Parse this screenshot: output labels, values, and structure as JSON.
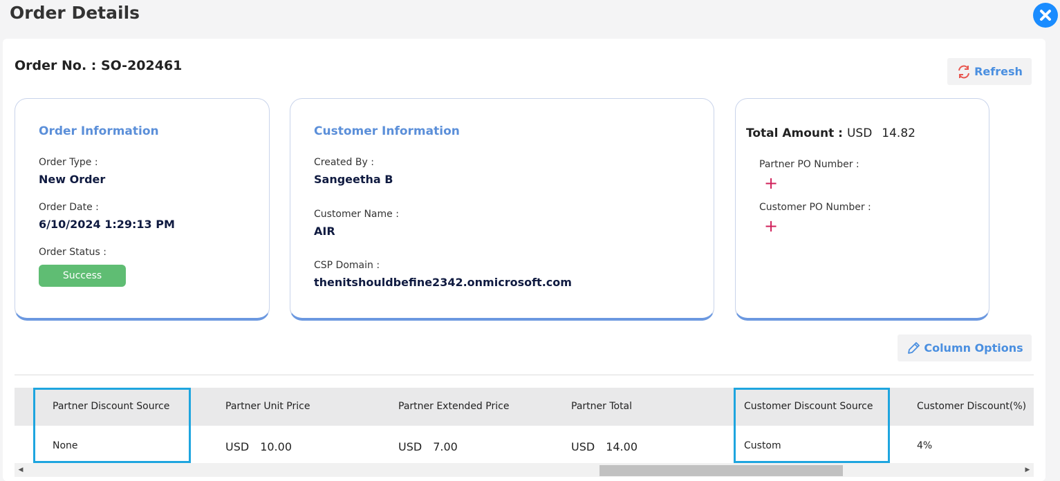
{
  "header": {
    "title": "Order Details"
  },
  "order": {
    "number_label": "Order No. : SO-202461"
  },
  "toolbar": {
    "refresh_label": "Refresh",
    "column_options_label": "Column Options"
  },
  "order_info": {
    "heading": "Order Information",
    "type_label": "Order Type :",
    "type_value": "New Order",
    "date_label": "Order Date :",
    "date_value": "6/10/2024 1:29:13 PM",
    "status_label": "Order Status :",
    "status_value": "Success"
  },
  "customer_info": {
    "heading": "Customer Information",
    "created_by_label": "Created By :",
    "created_by_value": "Sangeetha B",
    "customer_name_label": "Customer Name :",
    "customer_name_value": "AIR",
    "csp_domain_label": "CSP Domain :",
    "csp_domain_value": "thenitshouldbefine2342.onmicrosoft.com"
  },
  "totals": {
    "total_label": "Total Amount :",
    "currency": "USD",
    "amount": "14.82",
    "partner_po_label": "Partner PO Number :",
    "customer_po_label": "Customer PO Number :"
  },
  "table": {
    "columns": [
      "Partner Discount Source",
      "Partner Unit Price",
      "Partner Extended Price",
      "Partner Total",
      "Customer Discount Source",
      "Customer Discount(%)"
    ],
    "row": {
      "partner_discount_source": "None",
      "partner_unit_price": {
        "currency": "USD",
        "value": "10.00"
      },
      "partner_extended_price": {
        "currency": "USD",
        "value": "7.00"
      },
      "partner_total": {
        "currency": "USD",
        "value": "14.00"
      },
      "customer_discount_source": "Custom",
      "customer_discount_pct": "4%"
    }
  },
  "colors": {
    "accent": "#5b8fd9",
    "success": "#5fbd73",
    "highlight": "#1ea5df",
    "close": "#1a8cff",
    "plus": "#d0205a"
  },
  "icons": {
    "close": "close-icon",
    "refresh": "refresh-icon",
    "edit": "pencil-icon",
    "add": "plus-icon"
  }
}
